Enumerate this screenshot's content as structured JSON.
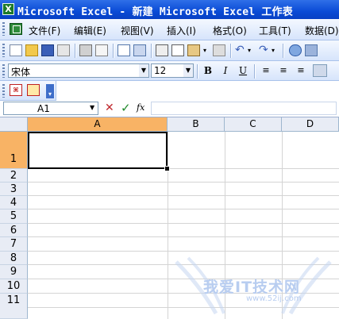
{
  "window": {
    "title": "Microsoft Excel - 新建 Microsoft Excel 工作表",
    "app_icon": "X"
  },
  "menubar": {
    "items": [
      "文件(F)",
      "编辑(E)",
      "视图(V)",
      "插入(I)",
      "格式(O)",
      "工具(T)",
      "数据(D)"
    ]
  },
  "toolbar_standard": {
    "icons": [
      "new-icon",
      "open-icon",
      "save-icon",
      "permission-icon",
      "print-icon",
      "print-preview-icon",
      "spelling-icon",
      "research-icon",
      "cut-icon",
      "copy-icon",
      "paste-icon",
      "format-painter-icon",
      "undo-icon",
      "redo-icon",
      "hyperlink-icon"
    ]
  },
  "toolbar_formatting": {
    "font_name": "宋体",
    "font_size": "12",
    "bold": "B",
    "italic": "I",
    "underline": "U"
  },
  "toolbar_pdf": {
    "icons": [
      "pdf-icon",
      "pdf-settings-icon"
    ]
  },
  "formula_bar": {
    "name_box": "A1",
    "cancel_symbol": "✕",
    "enter_symbol": "✓",
    "fx_label": "fx",
    "formula": ""
  },
  "sheet": {
    "columns": [
      "A",
      "B",
      "C",
      "D"
    ],
    "rows": [
      "1",
      "2",
      "3",
      "4",
      "5",
      "6",
      "7",
      "8",
      "9",
      "10",
      "11"
    ],
    "selected_cell": "A1"
  },
  "watermark": {
    "text": "我爱IT技术网",
    "url": "www.52ij.com"
  }
}
